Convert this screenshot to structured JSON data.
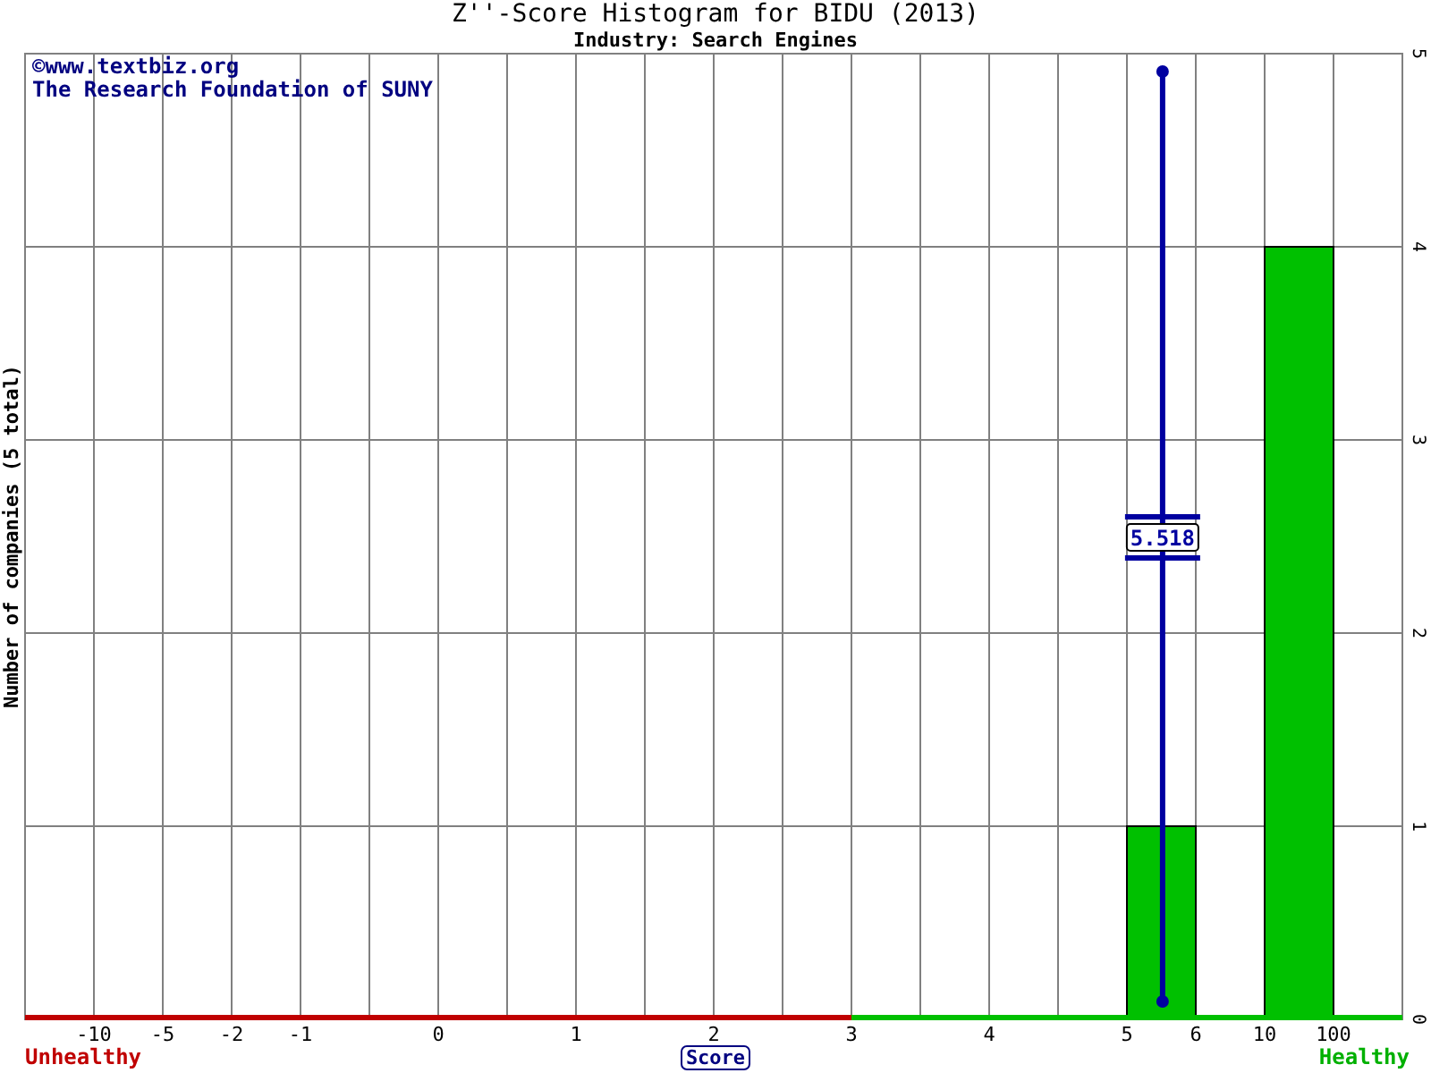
{
  "title": "Z''-Score Histogram for BIDU (2013)",
  "subtitle": "Industry: Search Engines",
  "credits": [
    "©www.textbiz.org",
    "The Research Foundation of SUNY"
  ],
  "left_label": "Unhealthy",
  "right_label": "Healthy",
  "score_ticks": [
    "-10",
    "-5",
    "-2",
    "-1",
    "0",
    "1",
    "2",
    "3",
    "4",
    "5",
    "6",
    "10",
    "100"
  ],
  "score_marker": {
    "label": "5.518"
  },
  "chart_data": {
    "type": "bar",
    "xlabel": "Score",
    "ylabel": "Number of companies (5 total)",
    "grid": true,
    "values": [
      0,
      0,
      0,
      0,
      0,
      0,
      0,
      0,
      0,
      0,
      0,
      0,
      0,
      0,
      0,
      0,
      1,
      0,
      4,
      0
    ],
    "ylim": [
      0,
      5
    ],
    "yticks": [
      0,
      1,
      2,
      3,
      4,
      5
    ]
  }
}
